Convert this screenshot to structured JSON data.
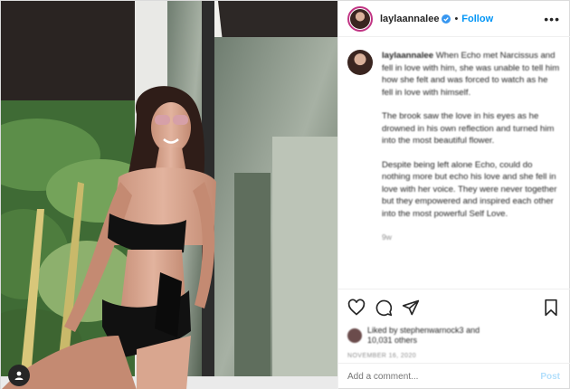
{
  "header": {
    "username": "laylaannalee",
    "dot": "•",
    "follow_label": "Follow",
    "more_label": "•••"
  },
  "caption": {
    "username": "laylaannalee",
    "paragraphs": [
      "When Echo met Narcissus and fell in love with him, she was unable to tell him how she felt and was forced to watch as he fell in love with himself.",
      "The brook saw the love in his eyes as he drowned in his own reflection and turned him into the most beautiful flower.",
      "Despite being left alone Echo, could do nothing more but echo his love and she fell in love with her voice. They were never together but they empowered and inspired each other into the most powerful Self Love."
    ],
    "time": "9w"
  },
  "likes": {
    "line1": "Liked by stephenwarnock3 and",
    "line2": "10,031 others"
  },
  "date": "NOVEMBER 16, 2020",
  "comment_box": {
    "placeholder": "Add a comment...",
    "post_label": "Post"
  },
  "icons": {
    "like": "heart-icon",
    "comment": "comment-icon",
    "share": "share-icon",
    "save": "bookmark-icon",
    "user_tag": "user-tag-icon",
    "verified": "verified-badge-icon",
    "more": "more-options-icon"
  },
  "colors": {
    "accent": "#0095f6",
    "text": "#262626",
    "muted": "#8e8e8e",
    "post_disabled": "#b2dffc"
  }
}
